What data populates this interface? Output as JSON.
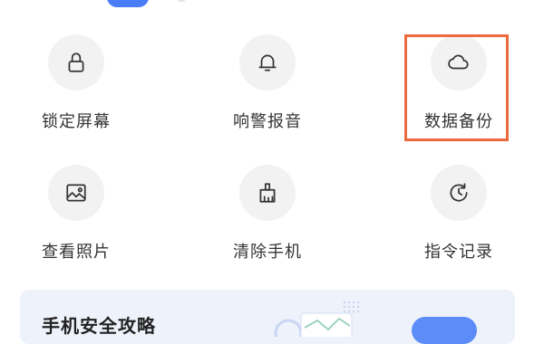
{
  "grid": {
    "items": [
      {
        "label": "锁定屏幕",
        "icon": "lock-icon"
      },
      {
        "label": "响警报音",
        "icon": "bell-icon"
      },
      {
        "label": "数据备份",
        "icon": "cloud-icon",
        "highlighted": true
      },
      {
        "label": "查看照片",
        "icon": "image-icon"
      },
      {
        "label": "清除手机",
        "icon": "broom-icon"
      },
      {
        "label": "指令记录",
        "icon": "history-icon"
      }
    ]
  },
  "banner": {
    "title": "手机安全攻略",
    "button_label": ""
  },
  "colors": {
    "highlight": "#ec6a3c",
    "accent": "#4a7cf6",
    "icon_bg": "#f2f2f2"
  }
}
